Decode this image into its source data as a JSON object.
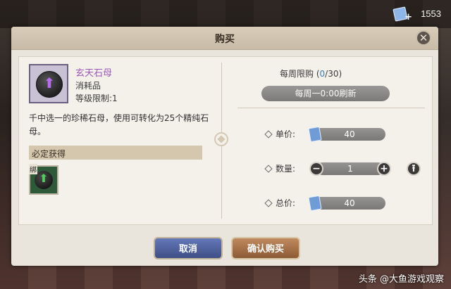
{
  "top_bar": {
    "currency_icon": "currency-ticket-plus-icon",
    "currency_value": "1553"
  },
  "dialog": {
    "title": "购买",
    "close_icon": "close-x-icon",
    "item": {
      "icon": "purple-up-arrow-stone-icon",
      "name": "玄天石母",
      "type": "消耗品",
      "level_limit": "等级限制:1",
      "description": "千中选一的珍稀石母，使用可转化为25个精纯石母。"
    },
    "reward": {
      "header": "必定获得",
      "bind_tag": "绑",
      "item_icon": "green-up-arrow-stone-icon"
    },
    "weekly_limit": {
      "label": "每周限购",
      "open": " (",
      "current": "0",
      "sep": "/",
      "max": "30",
      "close": ")"
    },
    "refresh_text": "每周一0:00刷新",
    "unit_price": {
      "label": "单价:",
      "value": "40",
      "icon": "ticket-icon"
    },
    "quantity": {
      "label": "数量:",
      "value": "1",
      "minus_icon": "minus-icon",
      "plus_icon": "plus-icon",
      "max_icon": "max-up-arrow-icon"
    },
    "total_price": {
      "label": "总价:",
      "value": "40",
      "icon": "ticket-icon"
    },
    "buttons": {
      "cancel": "取消",
      "confirm": "确认购买"
    }
  },
  "watermark": "头条 @大鱼游戏观察",
  "colors": {
    "item_name": "#9c56b8",
    "limit_current": "#3a78c8",
    "cancel_btn": "#4b5c98",
    "confirm_btn": "#a6704a"
  }
}
